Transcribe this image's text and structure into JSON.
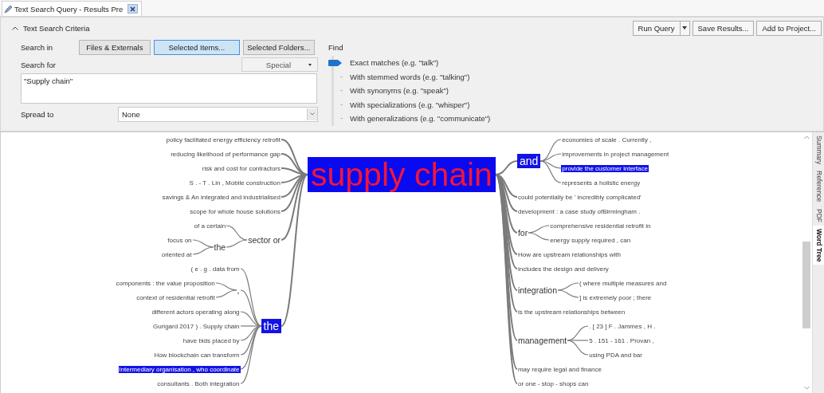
{
  "tab": {
    "title": "Text Search Query - Results Pre"
  },
  "criteria": {
    "title": "Text Search Criteria",
    "actions": [
      {
        "label": "Run Query",
        "kind": "split"
      },
      {
        "label": "Save Results...",
        "kind": "button"
      },
      {
        "label": "Add to Project...",
        "kind": "button"
      }
    ],
    "search_in": {
      "label": "Search in",
      "options": [
        {
          "label": "Files & Externals",
          "selected": false
        },
        {
          "label": "Selected Items...",
          "selected": true
        },
        {
          "label": "Selected Folders...",
          "selected": false
        }
      ]
    },
    "search_for": {
      "label": "Search for",
      "special": "Special",
      "value": "\"Supply chain\""
    },
    "spread_to": {
      "label": "Spread to",
      "value": "None"
    },
    "find": {
      "label": "Find",
      "options": [
        {
          "label": "Exact matches (e.g. \"talk\")",
          "selected": true
        },
        {
          "label": "With stemmed words (e.g. \"talking\")",
          "selected": false
        },
        {
          "label": "With synonyms (e.g. \"speak\")",
          "selected": false
        },
        {
          "label": "With specializations (e.g. \"whisper\")",
          "selected": false
        },
        {
          "label": "With generalizations (e.g. \"communicate\")",
          "selected": false
        }
      ]
    }
  },
  "word_tree": {
    "root": "supply chain",
    "left": [
      {
        "text": "policy facilitated energy efficiency retrofit",
        "highlighted": false
      },
      {
        "text": "reducing likelihood of performance gap",
        "highlighted": false
      },
      {
        "text": "risk and cost for contractors",
        "highlighted": false
      },
      {
        "text": "S . - T . Lin , Mobile construction",
        "highlighted": false
      },
      {
        "text": "savings & An integrated and industrialised",
        "highlighted": false
      },
      {
        "text": "scope for whole house solutions",
        "highlighted": false
      },
      {
        "text": "sector or",
        "highlighted": false,
        "children": [
          {
            "text": "of a certain",
            "highlighted": false
          },
          {
            "text": "the",
            "highlighted": false,
            "children": [
              {
                "text": "focus on",
                "highlighted": false
              },
              {
                "text": "oriented at",
                "highlighted": false
              }
            ]
          }
        ]
      },
      {
        "text": "the",
        "highlighted": true,
        "children": [
          {
            "text": "( e . g . data from",
            "highlighted": false
          },
          {
            "text": ",",
            "highlighted": false,
            "children": [
              {
                "text": "components : the value proposition",
                "highlighted": false
              },
              {
                "text": "context of residential retrofit",
                "highlighted": false
              }
            ]
          },
          {
            "text": "different actors operating along",
            "highlighted": false
          },
          {
            "text": "Gurigard 2017 ) . Supply chain",
            "highlighted": false
          },
          {
            "text": "have bids placed by",
            "highlighted": false
          },
          {
            "text": "How blockchain can transform",
            "highlighted": false
          },
          {
            "text": "intermediary organisation , who coordinate",
            "highlighted": true
          },
          {
            "text": "consultants . Both integration",
            "highlighted": false
          }
        ]
      }
    ],
    "right": [
      {
        "text": "and",
        "highlighted": true,
        "children": [
          {
            "text": "economies of scale . Currently ,",
            "highlighted": false
          },
          {
            "text": "improvements in project management",
            "highlighted": false
          },
          {
            "text": "provide the customer interface",
            "highlighted": true
          },
          {
            "text": "represents a holistic energy",
            "highlighted": false
          }
        ]
      },
      {
        "text": "could potentially be ' incredibly complicated'",
        "highlighted": false
      },
      {
        "text": "development : a case study ofBirmingham .",
        "highlighted": false
      },
      {
        "text": "for",
        "highlighted": false,
        "children": [
          {
            "text": "comprehensive residential retrofit in",
            "highlighted": false
          },
          {
            "text": "energy supply required , can",
            "highlighted": false
          }
        ]
      },
      {
        "text": "How are upstream relationships with",
        "highlighted": false
      },
      {
        "text": "includes the design and delivery",
        "highlighted": false
      },
      {
        "text": "integration",
        "highlighted": false,
        "children": [
          {
            "text": "( where multiple measures and",
            "highlighted": false
          },
          {
            "text": "] is extremely poor ; there",
            "highlighted": false
          }
        ]
      },
      {
        "text": "is the upstream relationships between",
        "highlighted": false
      },
      {
        "text": "management",
        "highlighted": false,
        "children": [
          {
            "text": ". [ 23 ] F . Jammes , H .",
            "highlighted": false
          },
          {
            "text": "5 . 151 - 161 . Provan ,",
            "highlighted": false
          },
          {
            "text": "using PDA and bar",
            "highlighted": false
          }
        ]
      },
      {
        "text": "may require legal and finance",
        "highlighted": false
      },
      {
        "text": "or one - stop - shops can",
        "highlighted": false
      }
    ]
  },
  "side_tabs": [
    {
      "label": "Summary",
      "selected": false
    },
    {
      "label": "Reference",
      "selected": false
    },
    {
      "label": "PDF",
      "selected": false
    },
    {
      "label": "Word Tree",
      "selected": true
    }
  ]
}
